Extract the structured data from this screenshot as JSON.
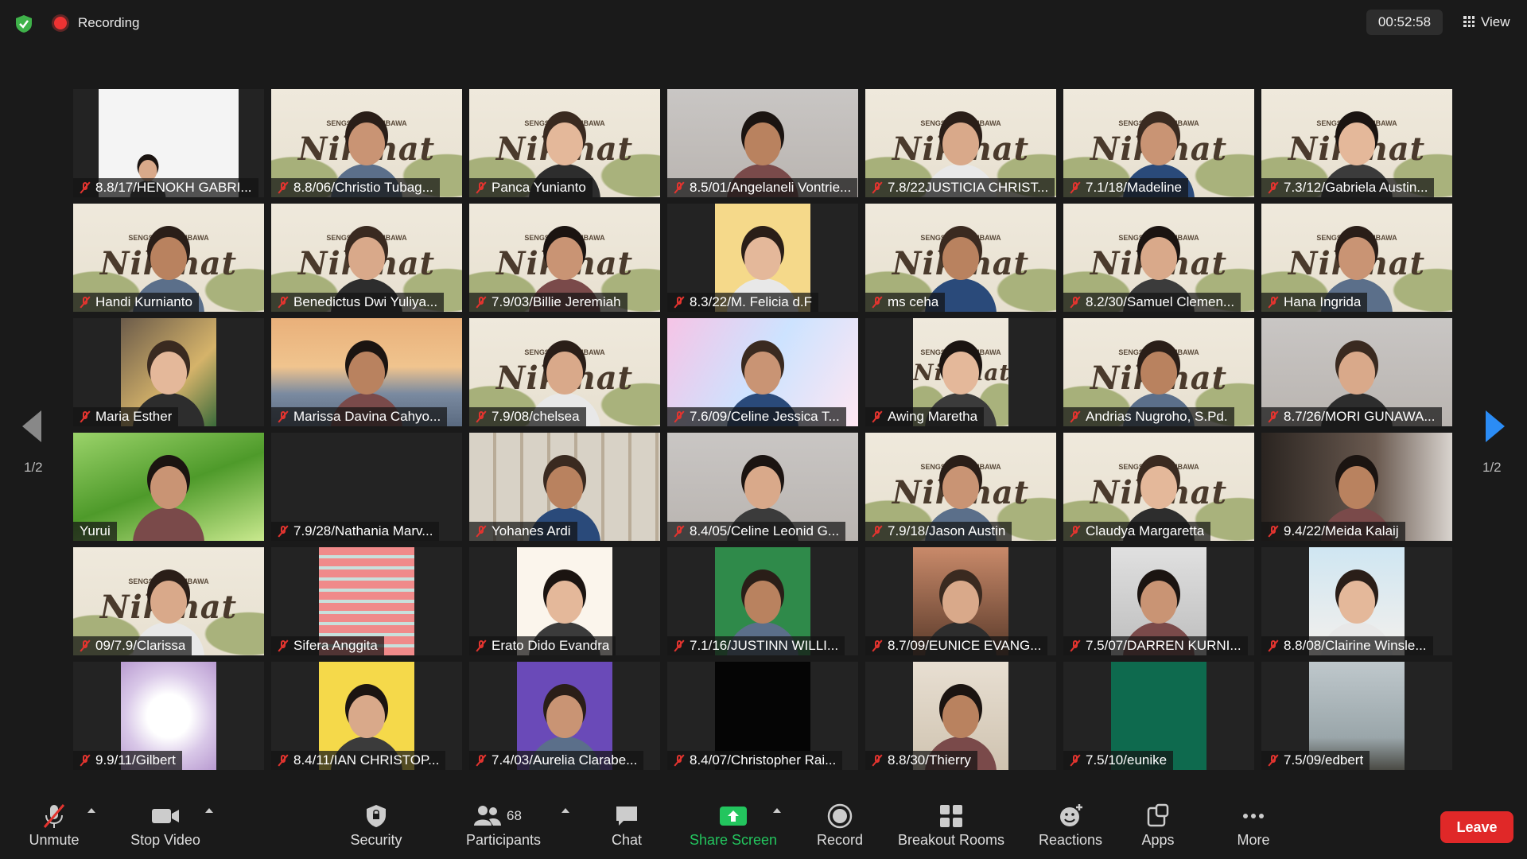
{
  "topbar": {
    "recording_label": "Recording",
    "timer": "00:52:58",
    "view_label": "View",
    "shield_color": "#3fb24a",
    "recording_color": "#e33333"
  },
  "navigation": {
    "page_left": "1/2",
    "page_right": "1/2"
  },
  "participants": [
    {
      "name": "8.8/17/HENOKH GABRI...",
      "muted": true,
      "bg": "plain-white"
    },
    {
      "name": "8.8/06/Christio Tubag...",
      "muted": true,
      "bg": "poster"
    },
    {
      "name": "Panca Yunianto",
      "muted": true,
      "bg": "poster"
    },
    {
      "name": "8.5/01/Angelaneli Vontrie...",
      "muted": true,
      "bg": "plain-grey"
    },
    {
      "name": "7.8/22JUSTICIA CHRIST...",
      "muted": true,
      "bg": "poster"
    },
    {
      "name": "7.1/18/Madeline",
      "muted": true,
      "bg": "poster"
    },
    {
      "name": "7.3/12/Gabriela Austin...",
      "muted": true,
      "bg": "poster"
    },
    {
      "name": "Handi Kurnianto",
      "muted": true,
      "bg": "poster"
    },
    {
      "name": "Benedictus Dwi Yuliya...",
      "muted": true,
      "bg": "poster"
    },
    {
      "name": "7.9/03/Billie Jeremiah",
      "muted": true,
      "bg": "poster"
    },
    {
      "name": "8.3/22/M. Felicia d.F",
      "muted": true,
      "bg": "avatar-frame"
    },
    {
      "name": "ms ceha",
      "muted": true,
      "bg": "poster"
    },
    {
      "name": "8.2/30/Samuel Clemen...",
      "muted": true,
      "bg": "poster"
    },
    {
      "name": "Hana Ingrida",
      "muted": true,
      "bg": "poster"
    },
    {
      "name": "Maria Esther",
      "muted": true,
      "bg": "room-small"
    },
    {
      "name": "Marissa Davina Cahyo...",
      "muted": true,
      "bg": "bridge"
    },
    {
      "name": "7.9/08/chelsea",
      "muted": true,
      "bg": "poster"
    },
    {
      "name": "7.6/09/Celine Jessica T...",
      "muted": true,
      "bg": "pastel"
    },
    {
      "name": "Awing Maretha",
      "muted": true,
      "bg": "poster-small"
    },
    {
      "name": "Andrias Nugroho, S.Pd.",
      "muted": true,
      "bg": "poster"
    },
    {
      "name": "8.7/26/MORI GUNAWA...",
      "muted": true,
      "bg": "plain-grey"
    },
    {
      "name": "Yurui",
      "muted": false,
      "bg": "grass",
      "active": true
    },
    {
      "name": "7.9/28/Nathania Marv...",
      "muted": true,
      "bg": "none"
    },
    {
      "name": "Yohanes Ardi",
      "muted": true,
      "bg": "bookshelf"
    },
    {
      "name": "8.4/05/Celine Leonid G...",
      "muted": true,
      "bg": "plain-grey"
    },
    {
      "name": "7.9/18/Jason Austin",
      "muted": true,
      "bg": "poster"
    },
    {
      "name": "Claudya Margaretta",
      "muted": true,
      "bg": "poster"
    },
    {
      "name": "9.4/22/Meida Kalaij",
      "muted": true,
      "bg": "dark-room"
    },
    {
      "name": "09/7.9/Clarissa",
      "muted": true,
      "bg": "poster"
    },
    {
      "name": "Sifera Anggita",
      "muted": true,
      "bg": "stadium"
    },
    {
      "name": "Erato Dido Evandra",
      "muted": true,
      "bg": "cartoon"
    },
    {
      "name": "7.1/16/JUSTINN WILLI...",
      "muted": true,
      "bg": "cat-cartoon"
    },
    {
      "name": "8.7/09/EUNICE EVANG...",
      "muted": true,
      "bg": "selfie"
    },
    {
      "name": "7.5/07/DARREN KURNI...",
      "muted": true,
      "bg": "sketch"
    },
    {
      "name": "8.8/08/Clairine Winsle...",
      "muted": true,
      "bg": "selfie-light"
    },
    {
      "name": "9.9/11/Gilbert",
      "muted": true,
      "bg": "blur-purple"
    },
    {
      "name": "8.4/11/IAN CHRISTOP...",
      "muted": true,
      "bg": "class-frame"
    },
    {
      "name": "7.4/03/Aurelia Clarabe...",
      "muted": true,
      "bg": "purple-frame"
    },
    {
      "name": "8.4/07/Christopher Rai...",
      "muted": true,
      "bg": "black"
    },
    {
      "name": "8.8/30/Thierry",
      "muted": true,
      "bg": "portrait"
    },
    {
      "name": "7.5/10/eunike",
      "muted": true,
      "bg": "green"
    },
    {
      "name": "7.5/09/edbert",
      "muted": true,
      "bg": "sky"
    }
  ],
  "poster": {
    "title": "Nikmat",
    "subtitle": "SENGSARA MEMBAWA"
  },
  "toolbar": {
    "unmute": "Unmute",
    "stop_video": "Stop Video",
    "security": "Security",
    "participants": "Participants",
    "participant_count": "68",
    "chat": "Chat",
    "share_screen": "Share Screen",
    "record": "Record",
    "breakout_rooms": "Breakout Rooms",
    "reactions": "Reactions",
    "apps": "Apps",
    "more": "More",
    "leave": "Leave",
    "share_color": "#23c55e",
    "leave_color": "#e02828"
  }
}
